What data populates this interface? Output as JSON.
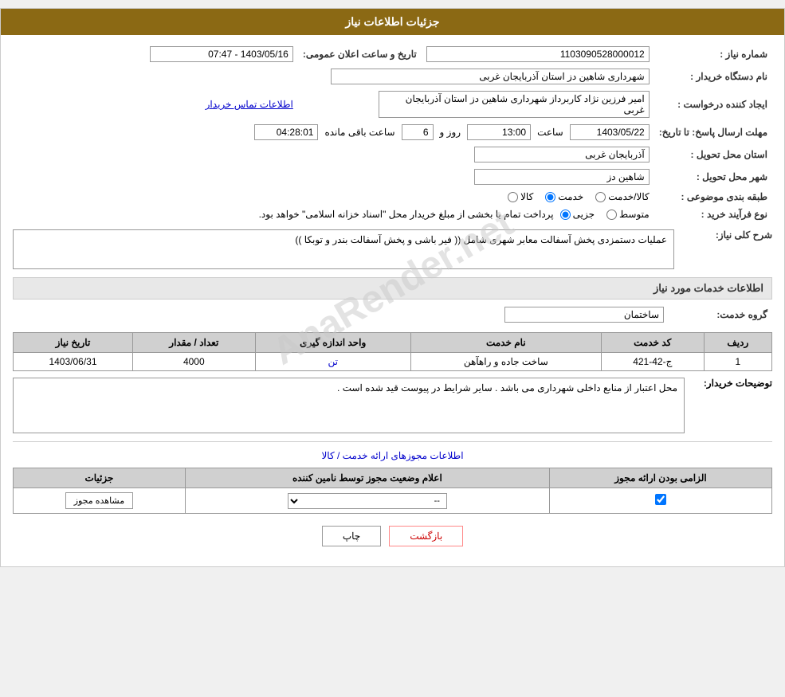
{
  "page": {
    "title": "جزئیات اطلاعات نیاز"
  },
  "fields": {
    "need_number_label": "شماره نیاز :",
    "need_number_value": "1103090528000012",
    "buyer_org_label": "نام دستگاه خریدار :",
    "buyer_org_value": "شهرداری شاهین دز استان آذربایجان غربی",
    "creator_label": "ایجاد کننده درخواست :",
    "creator_value": "امیر فرزین نژاد کاربرداز شهرداری شاهین دز استان آذربایجان غربی",
    "creator_link": "اطلاعات تماس خریدار",
    "reply_deadline_label": "مهلت ارسال پاسخ: تا تاریخ:",
    "reply_date": "1403/05/22",
    "reply_time_label": "ساعت",
    "reply_time": "13:00",
    "reply_day_label": "روز و",
    "reply_days": "6",
    "reply_remaining_label": "ساعت باقی مانده",
    "reply_remaining": "04:28:01",
    "announce_label": "تاریخ و ساعت اعلان عمومی:",
    "announce_value": "1403/05/16 - 07:47",
    "province_label": "استان محل تحویل :",
    "province_value": "آذربایجان غربی",
    "city_label": "شهر محل تحویل :",
    "city_value": "شاهین دز",
    "category_label": "طبقه بندی موضوعی :",
    "category_options": [
      {
        "label": "کالا",
        "name": "kala"
      },
      {
        "label": "خدمت",
        "name": "khedmat"
      },
      {
        "label": "کالا/خدمت",
        "name": "kala_khedmat"
      }
    ],
    "category_selected": "khedmat",
    "purchase_type_label": "نوع فرآیند خرید :",
    "purchase_type_note": "پرداخت تمام یا بخشی از مبلغ خریدار محل \"اسناد خزانه اسلامی\" خواهد بود.",
    "purchase_options": [
      {
        "label": "جزیی",
        "name": "jozi"
      },
      {
        "label": "متوسط",
        "name": "motavaset"
      }
    ],
    "purchase_selected": "jozi",
    "need_desc_label": "شرح کلی نیاز:",
    "need_desc_value": "عملیات دستمزدی پخش آسفالت معابر شهری شامل (( فیر باشی و پخش آسفالت بندر و توبکا ))",
    "services_label": "اطلاعات خدمات مورد نیاز",
    "service_group_label": "گروه خدمت:",
    "service_group_value": "ساختمان",
    "table": {
      "headers": [
        "ردیف",
        "کد خدمت",
        "نام خدمت",
        "واحد اندازه گیری",
        "تعداد / مقدار",
        "تاریخ نیاز"
      ],
      "rows": [
        {
          "row": "1",
          "code": "ج-42-421",
          "name": "ساخت جاده و راهآهن",
          "unit": "تن",
          "unit_link": true,
          "quantity": "4000",
          "date": "1403/06/31"
        }
      ]
    },
    "buyer_notes_label": "توضیحات خریدار:",
    "buyer_notes_value": "محل اعتبار از منابع داخلی شهرداری می باشد . سایر شرایط در پیوست قید شده است .",
    "permissions_title": "اطلاعات مجوزهای ارائه خدمت / کالا",
    "permissions_table": {
      "headers": [
        "الزامی بودن ارائه مجوز",
        "اعلام وضعیت مجوز توسط نامین کننده",
        "جزئیات"
      ],
      "rows": [
        {
          "required": true,
          "status": "--",
          "details_btn": "مشاهده مجوز"
        }
      ]
    },
    "btn_print": "چاپ",
    "btn_back": "بازگشت"
  }
}
